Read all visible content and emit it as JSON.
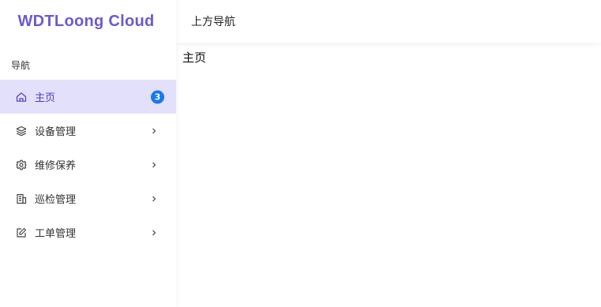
{
  "brand": {
    "name": "WDTLoong Cloud",
    "color": "#6a5ad0"
  },
  "sidebar": {
    "section_label": "导航",
    "active_bg": "#e3e0fb",
    "items": [
      {
        "label": "主页",
        "icon": "home-icon",
        "active": true,
        "badge": "3"
      },
      {
        "label": "设备管理",
        "icon": "layers-icon",
        "active": false,
        "has_submenu": true
      },
      {
        "label": "维修保养",
        "icon": "gear-icon",
        "active": false,
        "has_submenu": true
      },
      {
        "label": "巡检管理",
        "icon": "building-icon",
        "active": false,
        "has_submenu": true
      },
      {
        "label": "工单管理",
        "icon": "edit-icon",
        "active": false,
        "has_submenu": true
      }
    ]
  },
  "header": {
    "title": "上方导航"
  },
  "main": {
    "page_title": "主页"
  },
  "colors": {
    "badge": "#1877f2"
  }
}
